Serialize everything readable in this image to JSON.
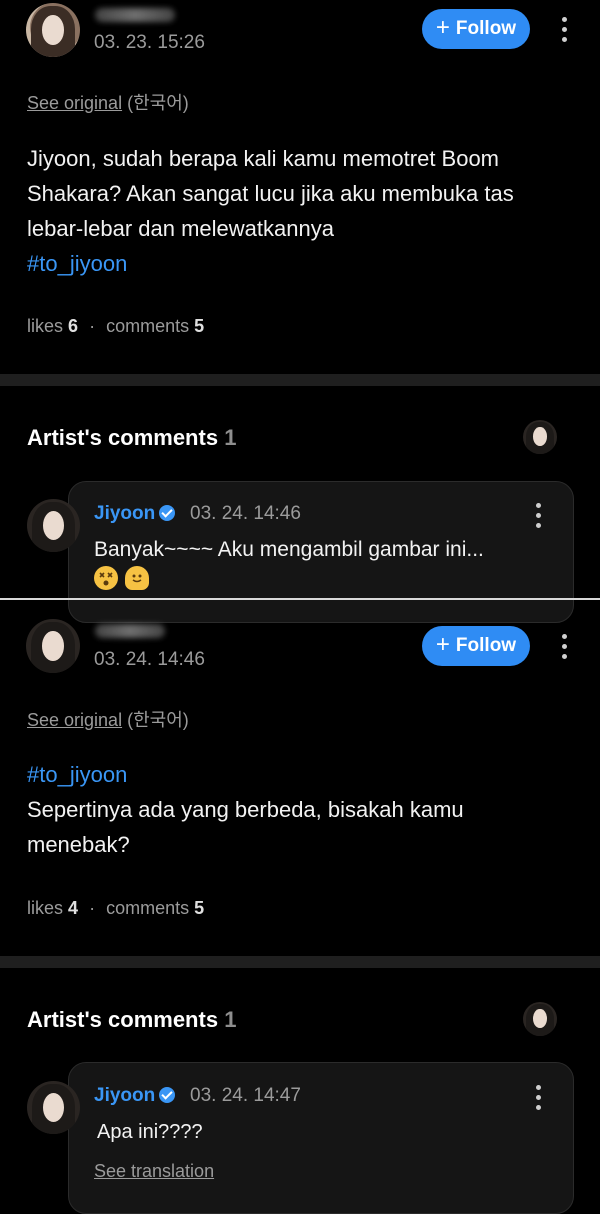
{
  "post1": {
    "time": "03. 23. 15:26",
    "follow_label": "Follow",
    "see_original": "See original",
    "language": "(한국어)",
    "text": "Jiyoon, sudah berapa kali kamu memotret Boom Shakara? Akan sangat lucu jika aku membuka tas lebar-lebar dan melewatkannya",
    "hashtag": "#to_jiyoon",
    "likes_label": "likes",
    "likes": "6",
    "comments_label": "comments",
    "comments": "5"
  },
  "artist1": {
    "title": "Artist's comments",
    "count": "1",
    "name": "Jiyoon",
    "time": "03. 24. 14:46",
    "text": "Banyak~~~~ Aku mengambil gambar ini...",
    "emojis": [
      "dizzy-face-emoji",
      "melting-face-emoji"
    ]
  },
  "post2": {
    "time": "03. 24. 14:46",
    "follow_label": "Follow",
    "see_original": "See original",
    "language": "(한국어)",
    "hashtag": "#to_jiyoon",
    "text": "Sepertinya ada yang berbeda, bisakah kamu menebak?",
    "likes_label": "likes",
    "likes": "4",
    "comments_label": "comments",
    "comments": "5"
  },
  "artist2": {
    "title": "Artist's comments",
    "count": "1",
    "name": "Jiyoon",
    "time": "03. 24. 14:47",
    "text": "Apa ini????",
    "see_translation": "See translation"
  },
  "colors": {
    "accent": "#2f8cf4",
    "hashtag": "#3a96f5",
    "background": "#000000",
    "muted": "#9b9b9b"
  }
}
